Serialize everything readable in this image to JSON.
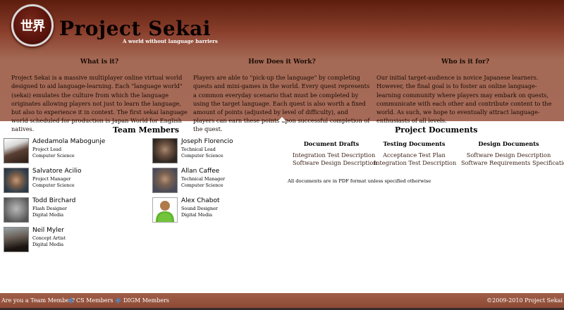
{
  "header": {
    "logo_text": "世界",
    "title": "Project Sekai",
    "tagline": "A world without language barriers"
  },
  "intro": [
    {
      "heading": "What is it?",
      "body": "Project Sekai is a massive multiplayer online virtual world designed to aid language-learning. Each \"language world\" (sekai) emulates the culture from which the language originates allowing players not just to learn the language, but also to experience it in context. The first sekai language world scheduled for production is Japan World for English natives."
    },
    {
      "heading": "How Does it Work?",
      "body": "Players are able to \"pick-up the language\" by completing quests and mini-games in the world. Every quest represents a common everyday scenario that must be completed by using the target language. Each quest is also worth a fixed amount of points (adjusted by level of difficulty), and players can earn these points upon successful completion of the quest."
    },
    {
      "heading": "Who is it for?",
      "body": "Our initial target-audience is novice Japanese learners. However, the final goal is to foster an online language-learning community where players may embark on quests, communicate with each other and contribute content to the world. As such, we hope to eventually attract language-enthusiasts of all levels."
    }
  ],
  "team": {
    "title": "Team Members",
    "members": [
      {
        "name": "Adedamola Mabogunje",
        "role": "Project Lead",
        "dept": "Computer Science"
      },
      {
        "name": "Joseph Florencio",
        "role": "Technical Lead",
        "dept": "Computer Science"
      },
      {
        "name": "Salvatore Acilio",
        "role": "Project Manager",
        "dept": "Computer Science"
      },
      {
        "name": "Allan Caffee",
        "role": "Technical Manager",
        "dept": "Computer Science"
      },
      {
        "name": "Todd Birchard",
        "role": "Flash Designer",
        "dept": "Digital Media"
      },
      {
        "name": "Alex Chabot",
        "role": "Sound Designer",
        "dept": "Digital Media"
      },
      {
        "name": "Neil Myler",
        "role": "Concept Artist",
        "dept": "Digital Media"
      }
    ]
  },
  "docs": {
    "title": "Project Documents",
    "columns": [
      {
        "heading": "Document Drafts",
        "links": [
          "Integration Test Description",
          "Software Design Description"
        ]
      },
      {
        "heading": "Testing Documents",
        "links": [
          "Acceptance Test Plan",
          "Integration Test Description"
        ]
      },
      {
        "heading": "Design Documents",
        "links": [
          "Software Design Description",
          "Software Requirements Specification"
        ]
      }
    ],
    "note": "All documents are in PDF format unless specified otherwise"
  },
  "footer": {
    "question": "Are you a Team Member?",
    "cs_link": "CS Members",
    "digm_link": "DIGM Members",
    "copyright": "©2009-2010 Project Sekai"
  },
  "colors": {
    "header_top": "#5c1d0e",
    "header_bottom": "#a66b58",
    "footer": "#8a4833"
  },
  "icons": [
    "avatar-placeholder-icon",
    "gear-link-icon"
  ]
}
